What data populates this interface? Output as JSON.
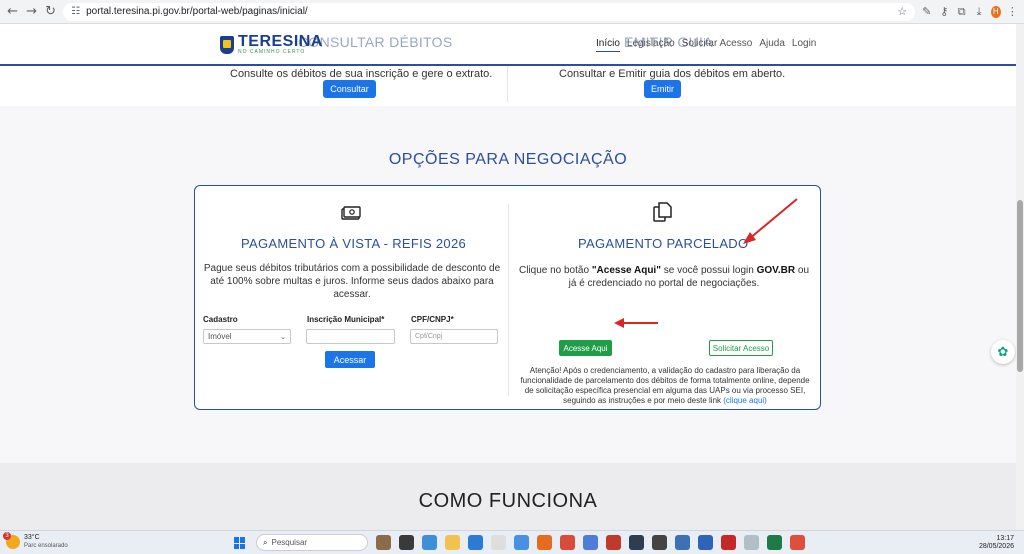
{
  "browser": {
    "url": "portal.teresina.pi.gov.br/portal-web/paginas/inicial/",
    "profile_initial": "H"
  },
  "header": {
    "logo_text": "TERESINA",
    "logo_tagline": "NO CAMINHO CERTO",
    "behind_left": "CONSULTAR DÉBITOS",
    "behind_right": "EMITIR GUIA",
    "nav": [
      "Início",
      "Legislação",
      "Solicitar Acesso",
      "Ajuda",
      "Login"
    ]
  },
  "services": {
    "consultar_desc": "Consulte os débitos de sua inscrição e gere o extrato.",
    "consultar_button": "Consultar",
    "emitir_desc": "Consultar e Emitir guia dos débitos em aberto.",
    "emitir_button": "Emitir"
  },
  "negotiation": {
    "section_title": "OPÇÕES PARA NEGOCIAÇÃO",
    "vista": {
      "title": "PAGAMENTO À VISTA - REFIS 2026",
      "description": "Pague seus débitos tributários com a possibilidade de desconto de até 100% sobre multas e juros. Informe seus dados abaixo para acessar.",
      "cadastro_label": "Cadastro",
      "cadastro_value": "Imóvel",
      "inscricao_label": "Inscrição Municipal*",
      "inscricao_value": "",
      "cpf_label": "CPF/CNPJ*",
      "cpf_placeholder": "Cpf/Cnpj",
      "button": "Acessar"
    },
    "parcelado": {
      "title": "PAGAMENTO PARCELADO",
      "desc_1": "Clique no botão ",
      "desc_bold_1": "\"Acesse Aqui\"",
      "desc_2": " se você possui login ",
      "desc_bold_2": "GOV.BR",
      "desc_3": " ou já é credenciado no portal de negociações.",
      "acesse_button": "Acesse Aqui",
      "solicitar_button": "Solicitar Acesso",
      "attention": "Atenção! Após o credenciamento, a validação do cadastro para liberação da funcionalidade de parcelamento dos débitos de forma totalmente online, depende de solicitação específica presencial em alguma das UAPs ou via processo SEI, seguindo as instruções e por meio deste link ",
      "attention_link": "(clique aqui)"
    }
  },
  "como_funciona": "COMO FUNCIONA",
  "taskbar": {
    "weather_badge": "3",
    "temperature": "33°C",
    "condition": "Parc ensolarado",
    "search_placeholder": "Pesquisar",
    "time": "13:17",
    "date": "28/05/2026"
  },
  "colors": {
    "brand_blue": "#2a4f9e",
    "button_blue": "#1b74e8",
    "button_green": "#1f9d47",
    "annotation_red": "#d62828"
  }
}
